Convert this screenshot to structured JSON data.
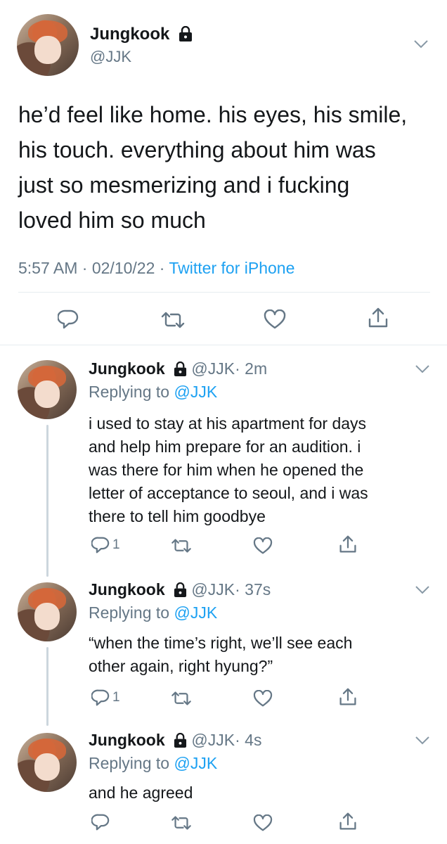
{
  "main_tweet": {
    "name": "Jungkook",
    "handle": "@JJK",
    "text_lines": [
      "he’d feel like home. his eyes, his smile,",
      "his touch. everything about him was",
      "just so mesmerizing and i fucking",
      "loved him so much"
    ],
    "time": "5:57 AM",
    "sep1": " · ",
    "date": "02/10/22",
    "sep2": " · ",
    "source": "Twitter for iPhone"
  },
  "replies": [
    {
      "name": "Jungkook",
      "handle": "@JJK",
      "age": "· 2m",
      "replying_prefix": "Replying to ",
      "replying_handle": "@JJK",
      "text_lines": [
        "i used to stay at his apartment for days",
        "and help him prepare for an audition. i",
        "was there for him when he opened the",
        "letter of acceptance to seoul, and i was",
        "there to tell him goodbye"
      ],
      "reply_count": "1"
    },
    {
      "name": "Jungkook",
      "handle": "@JJK",
      "age": "· 37s",
      "replying_prefix": "Replying to ",
      "replying_handle": "@JJK",
      "text_lines": [
        "“when the time’s right, we’ll see each",
        "other again, right hyung?”"
      ],
      "reply_count": "1"
    },
    {
      "name": "Jungkook",
      "handle": "@JJK",
      "age": "· 4s",
      "replying_prefix": "Replying to ",
      "replying_handle": "@JJK",
      "text_lines": [
        "and he agreed"
      ],
      "reply_count": ""
    }
  ],
  "icons": {
    "reply": "reply-icon",
    "retweet": "retweet-icon",
    "like": "like-icon",
    "share": "share-icon",
    "lock": "lock-icon",
    "more": "chevron-down-icon"
  },
  "colors": {
    "text": "#14171a",
    "secondary": "#657786",
    "link": "#1da1f2",
    "divider": "#e6ecf0",
    "thread_line": "#ccd6dd"
  }
}
